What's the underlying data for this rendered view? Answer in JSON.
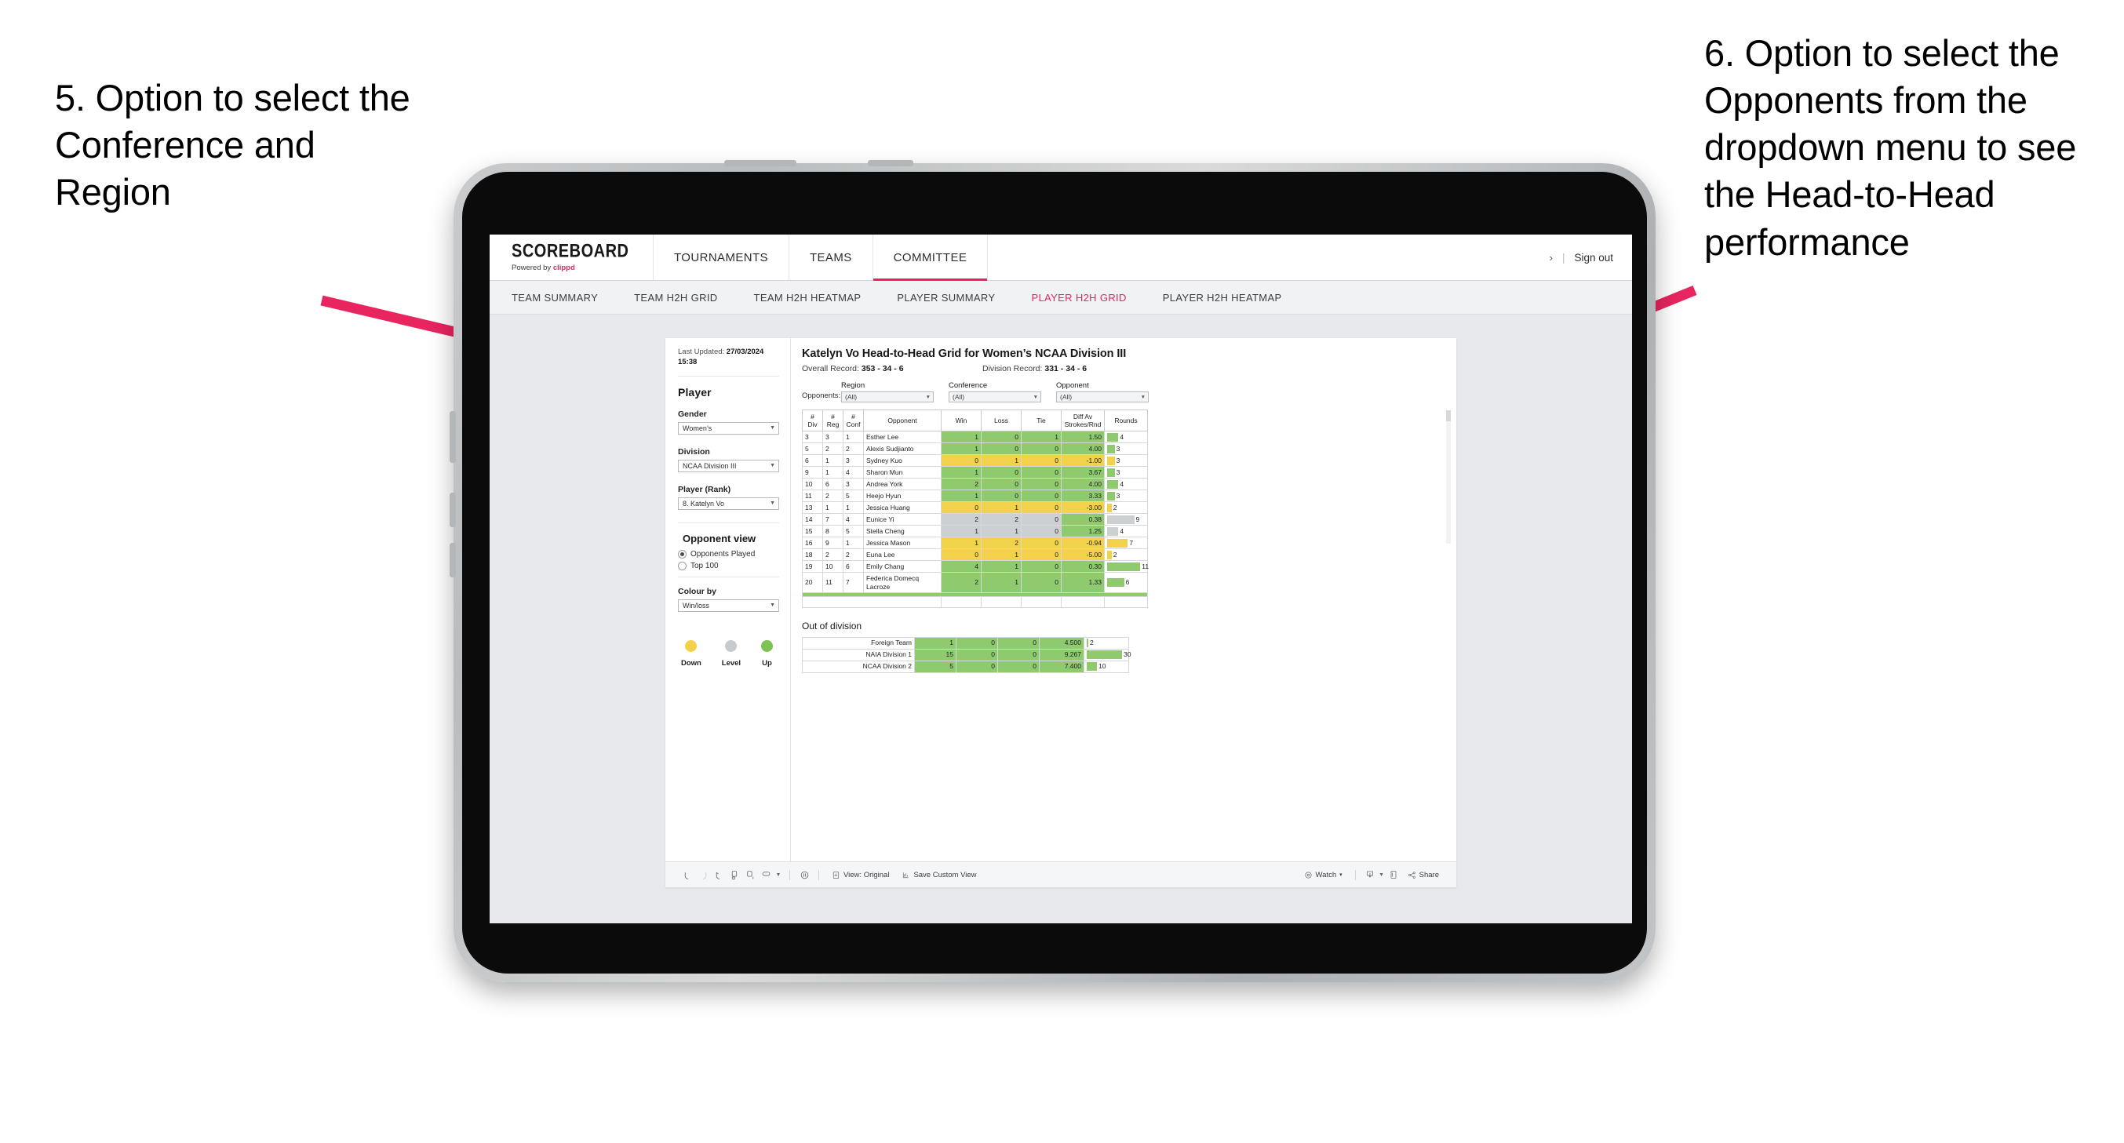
{
  "annotations": {
    "left": "5. Option to select the Conference and Region",
    "right": "6. Option to select the Opponents from the dropdown menu to see the Head-to-Head performance",
    "arrow_color": "#e8255f"
  },
  "app": {
    "brand": {
      "title": "SCOREBOARD",
      "powered_prefix": "Powered by ",
      "powered_brand": "clippd"
    },
    "nav": [
      {
        "label": "TOURNAMENTS",
        "active": false
      },
      {
        "label": "TEAMS",
        "active": false
      },
      {
        "label": "COMMITTEE",
        "active": true
      }
    ],
    "header_right": {
      "chevron": "›",
      "separator": "|",
      "sign_out": "Sign out"
    },
    "sub_nav": [
      {
        "label": "TEAM SUMMARY",
        "active": false
      },
      {
        "label": "TEAM H2H GRID",
        "active": false
      },
      {
        "label": "TEAM H2H HEATMAP",
        "active": false
      },
      {
        "label": "PLAYER SUMMARY",
        "active": false
      },
      {
        "label": "PLAYER H2H GRID",
        "active": true
      },
      {
        "label": "PLAYER H2H HEATMAP",
        "active": false
      }
    ]
  },
  "sidebar": {
    "last_updated_label": "Last Updated: ",
    "last_updated_value": "27/03/2024",
    "last_updated_time": "15:38",
    "heading": "Player",
    "fields": [
      {
        "label": "Gender",
        "value": "Women’s"
      },
      {
        "label": "Division",
        "value": "NCAA Division III"
      },
      {
        "label": "Player (Rank)",
        "value": "8. Katelyn Vo"
      }
    ],
    "opponent_view": {
      "heading": "Opponent view",
      "options": [
        {
          "label": "Opponents Played",
          "selected": true
        },
        {
          "label": "Top 100",
          "selected": false
        }
      ]
    },
    "colour_by": {
      "label": "Colour by",
      "value": "Win/loss"
    },
    "legend": [
      {
        "label": "Down",
        "color": "#f2d24b"
      },
      {
        "label": "Level",
        "color": "#c7cacc"
      },
      {
        "label": "Up",
        "color": "#7dc255"
      }
    ]
  },
  "content": {
    "title": "Katelyn Vo Head-to-Head Grid for Women’s NCAA Division III",
    "overall_record_label": "Overall Record: ",
    "overall_record_value": "353 -  34 - 6",
    "division_record_label": "Division Record: ",
    "division_record_value": "331 -  34 - 6",
    "opponents_label": "Opponents:",
    "filters": [
      {
        "label": "Region",
        "value": "(All)"
      },
      {
        "label": "Conference",
        "value": "(All)"
      },
      {
        "label": "Opponent",
        "value": "(All)"
      }
    ],
    "out_of_division_heading": "Out of division",
    "toolbar": {
      "view_label": "View: Original",
      "save_label": "Save Custom View",
      "watch_label": "Watch",
      "share_label": "Share",
      "caret": "▾"
    }
  },
  "chart_data": {
    "type": "table",
    "title": "Katelyn Vo Head-to-Head Grid for Women’s NCAA Division III",
    "columns": [
      "# Div",
      "# Reg",
      "# Conf",
      "Opponent",
      "Win",
      "Loss",
      "Tie",
      "Diff Av Strokes/Rnd",
      "Rounds"
    ],
    "column_headers_multiline": [
      {
        "line1": "#",
        "line2": "Div"
      },
      {
        "line1": "#",
        "line2": "Reg"
      },
      {
        "line1": "#",
        "line2": "Conf"
      },
      {
        "line1": "Opponent",
        "line2": ""
      },
      {
        "line1": "Win",
        "line2": ""
      },
      {
        "line1": "Loss",
        "line2": ""
      },
      {
        "line1": "Tie",
        "line2": ""
      },
      {
        "line1": "Diff Av",
        "line2": "Strokes/Rnd"
      },
      {
        "line1": "Rounds",
        "line2": ""
      }
    ],
    "rows": [
      {
        "div": "3",
        "reg": "3",
        "conf": "1",
        "opponent": "Esther Lee",
        "win": "1",
        "loss": "0",
        "tie": "1",
        "diff": "1.50",
        "rounds": "4",
        "rounds_pct": 30,
        "color": "g"
      },
      {
        "div": "5",
        "reg": "2",
        "conf": "2",
        "opponent": "Alexis Sudjianto",
        "win": "1",
        "loss": "0",
        "tie": "0",
        "diff": "4.00",
        "rounds": "3",
        "rounds_pct": 20,
        "color": "g"
      },
      {
        "div": "6",
        "reg": "1",
        "conf": "3",
        "opponent": "Sydney Kuo",
        "win": "0",
        "loss": "1",
        "tie": "0",
        "diff": "-1.00",
        "rounds": "3",
        "rounds_pct": 20,
        "color": "y"
      },
      {
        "div": "9",
        "reg": "1",
        "conf": "4",
        "opponent": "Sharon Mun",
        "win": "1",
        "loss": "0",
        "tie": "0",
        "diff": "3.67",
        "rounds": "3",
        "rounds_pct": 20,
        "color": "g"
      },
      {
        "div": "10",
        "reg": "6",
        "conf": "3",
        "opponent": "Andrea York",
        "win": "2",
        "loss": "0",
        "tie": "0",
        "diff": "4.00",
        "rounds": "4",
        "rounds_pct": 30,
        "color": "g"
      },
      {
        "div": "11",
        "reg": "2",
        "conf": "5",
        "opponent": "Heejo Hyun",
        "win": "1",
        "loss": "0",
        "tie": "0",
        "diff": "3.33",
        "rounds": "3",
        "rounds_pct": 20,
        "color": "g"
      },
      {
        "div": "13",
        "reg": "1",
        "conf": "1",
        "opponent": "Jessica Huang",
        "win": "0",
        "loss": "1",
        "tie": "0",
        "diff": "-3.00",
        "rounds": "2",
        "rounds_pct": 12,
        "color": "y"
      },
      {
        "div": "14",
        "reg": "7",
        "conf": "4",
        "opponent": "Eunice Yi",
        "win": "2",
        "loss": "2",
        "tie": "0",
        "diff": "0.38",
        "rounds": "9",
        "rounds_pct": 72,
        "color": "n",
        "diff_color": "g"
      },
      {
        "div": "15",
        "reg": "8",
        "conf": "5",
        "opponent": "Stella Cheng",
        "win": "1",
        "loss": "1",
        "tie": "0",
        "diff": "1.25",
        "rounds": "4",
        "rounds_pct": 30,
        "color": "n",
        "diff_color": "g"
      },
      {
        "div": "16",
        "reg": "9",
        "conf": "1",
        "opponent": "Jessica Mason",
        "win": "1",
        "loss": "2",
        "tie": "0",
        "diff": "-0.94",
        "rounds": "7",
        "rounds_pct": 55,
        "color": "y"
      },
      {
        "div": "18",
        "reg": "2",
        "conf": "2",
        "opponent": "Euna Lee",
        "win": "0",
        "loss": "1",
        "tie": "0",
        "diff": "-5.00",
        "rounds": "2",
        "rounds_pct": 12,
        "color": "y"
      },
      {
        "div": "19",
        "reg": "10",
        "conf": "6",
        "opponent": "Emily Chang",
        "win": "4",
        "loss": "1",
        "tie": "0",
        "diff": "0.30",
        "rounds": "11",
        "rounds_pct": 88,
        "color": "g"
      },
      {
        "div": "20",
        "reg": "11",
        "conf": "7",
        "opponent": "Federica Domecq Lacroze",
        "win": "2",
        "loss": "1",
        "tie": "0",
        "diff": "1.33",
        "rounds": "6",
        "rounds_pct": 45,
        "color": "g"
      }
    ],
    "out_of_division": [
      {
        "name": "Foreign Team",
        "win": "1",
        "loss": "0",
        "tie": "0",
        "diff": "4.500",
        "rounds": "2",
        "rounds_pct": 4,
        "color": "g"
      },
      {
        "name": "NAIA Division 1",
        "win": "15",
        "loss": "0",
        "tie": "0",
        "diff": "9.267",
        "rounds": "30",
        "rounds_pct": 90,
        "color": "g"
      },
      {
        "name": "NCAA Division 2",
        "win": "5",
        "loss": "0",
        "tie": "0",
        "diff": "7.400",
        "rounds": "10",
        "rounds_pct": 26,
        "color": "g"
      }
    ],
    "colors": {
      "up": "#8fcb6e",
      "down": "#f2d24b",
      "level": "#cdd0d2"
    }
  }
}
